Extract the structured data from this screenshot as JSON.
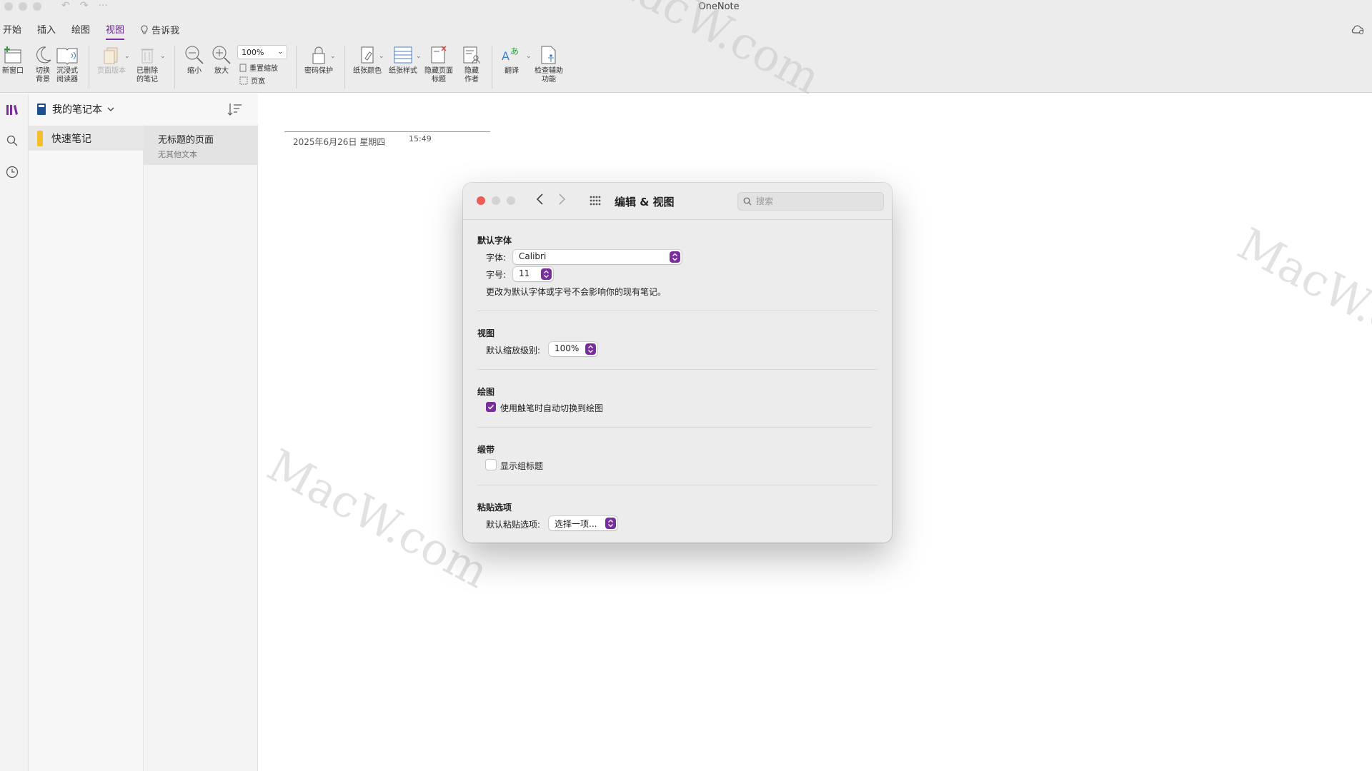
{
  "app": {
    "title": "OneNote"
  },
  "menu_tabs": [
    "开始",
    "插入",
    "绘图",
    "视图",
    "告诉我"
  ],
  "ribbon": {
    "new_window": "新窗口",
    "switch_bg": [
      "切换",
      "背景"
    ],
    "immersive": [
      "沉浸式",
      "阅读器"
    ],
    "page_versions": "页面版本",
    "deleted_notes": [
      "已删除",
      "的笔记"
    ],
    "zoom_out": "缩小",
    "zoom_in": "放大",
    "zoom_value": "100%",
    "reset_zoom": "重置缩放",
    "page_width": "页宽",
    "password": "密码保护",
    "paper_color": "纸张颜色",
    "paper_style": "纸张样式",
    "hide_title": [
      "隐藏页面",
      "标题"
    ],
    "hide_author": [
      "隐藏",
      "作者"
    ],
    "translate": "翻译",
    "accessibility": [
      "检查辅助",
      "功能"
    ]
  },
  "notebook": {
    "name": "我的笔记本",
    "section": "快速笔记",
    "page_title": "无标题的页面",
    "page_subtitle": "无其他文本"
  },
  "canvas": {
    "date": "2025年6月26日 星期四",
    "time": "15:49"
  },
  "watermark": "MacW.com",
  "dialog": {
    "title": "编辑 & 视图",
    "search_placeholder": "搜索",
    "default_font": {
      "heading": "默认字体",
      "font_label": "字体:",
      "font_value": "Calibri",
      "size_label": "字号:",
      "size_value": "11",
      "note": "更改为默认字体或字号不会影响你的现有笔记。"
    },
    "view": {
      "heading": "视图",
      "zoom_label": "默认缩放级别:",
      "zoom_value": "100%"
    },
    "drawing": {
      "heading": "绘图",
      "auto_switch_label": "使用触笔时自动切换到绘图",
      "auto_switch_checked": true
    },
    "ribbon": {
      "heading": "缎带",
      "show_group_titles_label": "显示组标题",
      "show_group_titles_checked": false
    },
    "paste": {
      "heading": "粘贴选项",
      "default_label": "默认粘贴选项:",
      "default_value": "选择一项..."
    }
  },
  "colors": {
    "accent": "#7a2e9e",
    "close": "#ee5c54",
    "section_tab": "#f2be2b"
  }
}
